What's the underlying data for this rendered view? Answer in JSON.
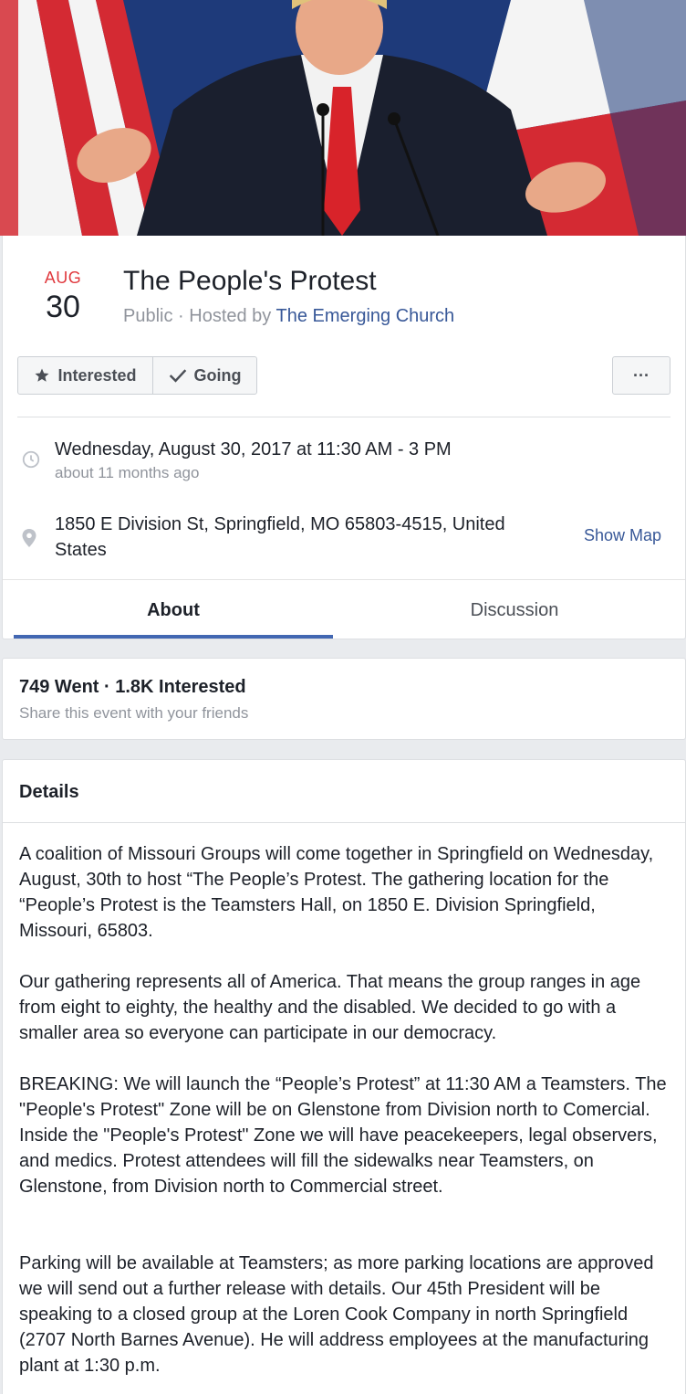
{
  "cover": {
    "colors": {
      "flag_red": "#d42a33",
      "flag_white": "#f4f4f4",
      "flag_blue": "#1e3a7a",
      "suit": "#1a1f2e",
      "tie": "#d8232a"
    }
  },
  "event": {
    "month": "AUG",
    "day": "30",
    "title": "The People's Protest",
    "privacy": "Public",
    "hosted_by_prefix": " · Hosted by ",
    "host": "The Emerging Church"
  },
  "actions": {
    "interested_label": "Interested",
    "going_label": "Going",
    "more_label": "···"
  },
  "time": {
    "datetime": "Wednesday, August 30, 2017 at 11:30 AM - 3 PM",
    "relative": "about 11 months ago"
  },
  "location": {
    "line1": "1850 E Division St, Springfield, MO 65803-4515, United",
    "line2": "States",
    "show_map_label": "Show Map"
  },
  "tabs": [
    {
      "label": "About",
      "active": true
    },
    {
      "label": "Discussion",
      "active": false
    }
  ],
  "stats": {
    "summary": "749 Went · 1.8K Interested",
    "share_text": "Share this event with your friends"
  },
  "details": {
    "header": "Details",
    "paragraphs": [
      "A coalition of Missouri Groups will come together in Springfield on Wednesday, August, 30th to host “The People’s Protest. The gathering location for the “People’s Protest is the Teamsters Hall, on 1850 E. Division Springfield, Missouri, 65803.",
      "Our gathering represents all of America. That means the group ranges in age from eight to eighty, the healthy and the disabled. We decided to go with a smaller area so everyone can participate in our democracy.",
      "BREAKING: We will launch the “People’s Protest” at 11:30 AM a Teamsters. The \"People's Protest\" Zone will be on Glenstone from Division north to Comercial. Inside the \"People's Protest\" Zone we will have peacekeepers, legal observers, and medics. Protest attendees will fill the sidewalks near Teamsters, on Glenstone, from Division north to Commercial street.",
      "Parking will be available at Teamsters; as more parking locations are approved we will send out a further release with details. Our 45th President will be speaking to a closed group at the Loren Cook Company in north Springfield (2707 North Barnes Avenue). He will address employees at the manufacturing plant at 1:30 p.m."
    ]
  },
  "icons": {
    "star": "star-icon",
    "check": "check-icon",
    "clock": "clock-icon",
    "pin": "map-pin-icon"
  },
  "theme": {
    "link_color": "#385898",
    "accent_blue": "#4267b2",
    "month_red": "#e0393e",
    "secondary_text": "#90949c"
  }
}
